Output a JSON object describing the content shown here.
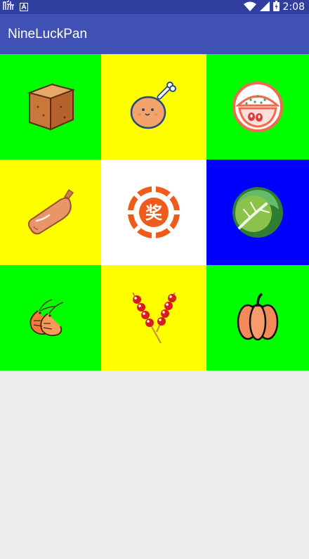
{
  "status_bar": {
    "time": "2:08",
    "icons": [
      "notification-icon",
      "download-icon",
      "wifi-icon",
      "signal-icon",
      "battery-icon"
    ]
  },
  "app_bar": {
    "title": "NineLuckPan"
  },
  "grid": {
    "cells": [
      {
        "name": "tofu",
        "icon": "tofu-icon",
        "color": "#00ff00"
      },
      {
        "name": "chicken-drumstick",
        "icon": "drumstick-icon",
        "color": "#ffff00"
      },
      {
        "name": "rice-bowl",
        "icon": "rice-bowl-icon",
        "color": "#00ff00"
      },
      {
        "name": "sausage",
        "icon": "sausage-icon",
        "color": "#ffff00"
      },
      {
        "name": "prize",
        "icon": "prize-icon",
        "color": "#ffffff",
        "label": "奖"
      },
      {
        "name": "cabbage",
        "icon": "cabbage-icon",
        "color": "#0000ff"
      },
      {
        "name": "shrimp",
        "icon": "shrimp-icon",
        "color": "#00ff00"
      },
      {
        "name": "skewers",
        "icon": "skewers-icon",
        "color": "#ffff00"
      },
      {
        "name": "pumpkin",
        "icon": "pumpkin-icon",
        "color": "#00ff00"
      }
    ]
  },
  "colors": {
    "status_bar": "#303f9f",
    "app_bar": "#3f51b5",
    "background": "#eeeeee",
    "prize_accent": "#f05a1a"
  }
}
